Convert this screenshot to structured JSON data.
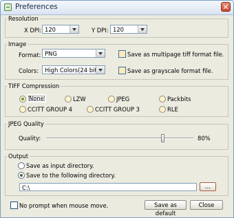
{
  "window": {
    "title": "Preferences"
  },
  "resolution": {
    "label": "Resolution",
    "x_dpi_label": "X DPI:",
    "x_dpi_value": "120",
    "y_dpi_label": "Y DPI:",
    "y_dpi_value": "120"
  },
  "image": {
    "label": "Image",
    "format_label": "Format:",
    "format_value": "PNG",
    "colors_label": "Colors:",
    "colors_value": "High Colors(24 bits)",
    "multipage_label": "Save as multipage tiff format file.",
    "grayscale_label": "Save as grayscale format file."
  },
  "tiff": {
    "label": "TIFF Compression",
    "options": [
      "None",
      "LZW",
      "JPEG",
      "Packbits",
      "CCITT GROUP 4",
      "CCITT GROUP 3",
      "RLE"
    ],
    "selected": "None"
  },
  "jpeg": {
    "label": "JPEG Quality",
    "quality_label": "Quality:",
    "quality_value": 0.8,
    "quality_text": "80%"
  },
  "output": {
    "label": "Output",
    "opt_input_dir": "Save as input directory.",
    "opt_following_dir": "Save to the following directory.",
    "selected": "following",
    "path": "C:\\",
    "browse_label": "..."
  },
  "footer": {
    "no_prompt_label": "No prompt when mouse move.",
    "save_default_label": "Save as default",
    "close_label": "Close"
  }
}
